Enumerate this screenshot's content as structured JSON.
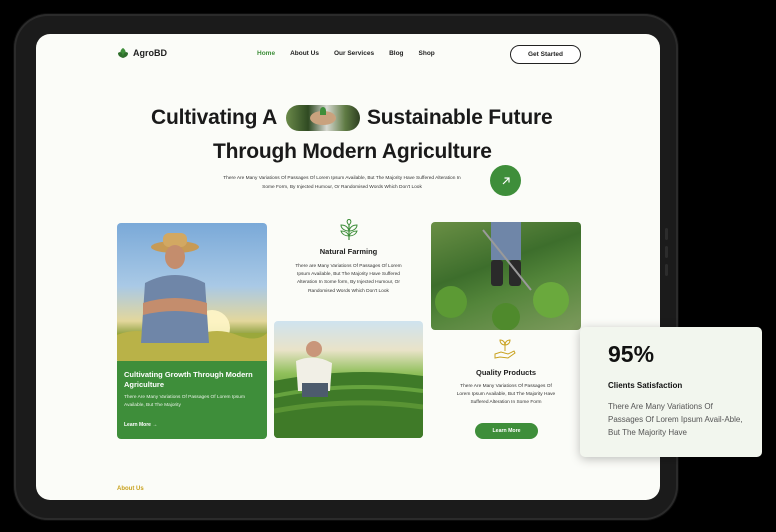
{
  "brand": {
    "name": "AgroBD"
  },
  "nav": {
    "items": [
      {
        "label": "Home",
        "active": true
      },
      {
        "label": "About Us",
        "active": false
      },
      {
        "label": "Our Services",
        "active": false
      },
      {
        "label": "Blog",
        "active": false
      },
      {
        "label": "Shop",
        "active": false
      }
    ],
    "cta_label": "Get Started"
  },
  "hero": {
    "title_line1_part1": "Cultivating A",
    "title_line1_part2": "Sustainable Future",
    "title_line2": "Through Modern Agriculture",
    "subtext": "There Are Many Variations Of Passages Of Lorem Ipsum Available, But The Majority Have Suffered Alteration In Some Form, By Injected Humour, Or Randomised Words Which Don't Look"
  },
  "cards": {
    "growth": {
      "title": "Cultivating Growth Through Modern Agriculture",
      "desc": "There Are Many Variations Of Passages Of Lorem Ipsum Available, But The Majority",
      "link": "Learn More →"
    },
    "natural_farming": {
      "title": "Natural Farming",
      "desc": "There are Many Variations Of Passages Of Lorem Ipsum Available, But The Majority Have Suffered Alteration In Some form, By Injected Humour, Or Randomised Words Which Don't Look"
    },
    "quality_products": {
      "title": "Quality Products",
      "desc": "There Are Many Variations Of Passages Of Lorem Ipsum Available, But The Majority Have Suffered Alteration In Some Form",
      "button": "Learn More"
    }
  },
  "about_label": "About Us",
  "stats": {
    "value": "95%",
    "label": "Clients Satisfaction",
    "desc": "There Are Many Variations Of Passages Of Lorem Ipsum Avail-Able, But The Majority Have"
  },
  "colors": {
    "accent": "#3e8e3a",
    "gold": "#c9a21f",
    "frame": "#1b1b1b"
  }
}
